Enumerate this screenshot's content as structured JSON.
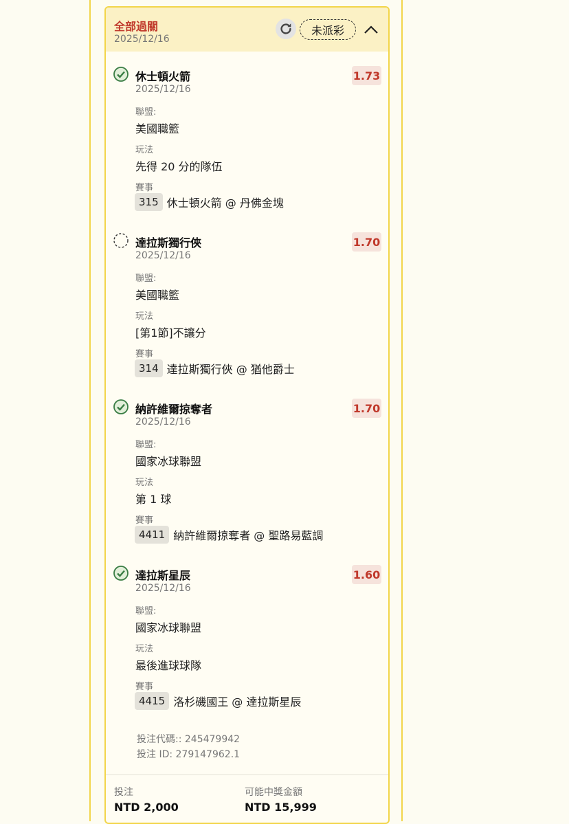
{
  "header": {
    "title": "全部過關",
    "date": "2025/12/16",
    "status": "未派彩"
  },
  "selections": [
    {
      "status": "won",
      "team": "休士頓火箭",
      "date": "2025/12/16",
      "odds": "1.73",
      "league_label": "聯盟:",
      "league": "美國職籃",
      "market_label": "玩法",
      "market": "先得 20 分的隊伍",
      "match_label": "賽事",
      "match_id": "315",
      "match_name": "休士頓火箭 @ 丹佛金塊"
    },
    {
      "status": "pending",
      "team": "達拉斯獨行俠",
      "date": "2025/12/16",
      "odds": "1.70",
      "league_label": "聯盟:",
      "league": "美國職籃",
      "market_label": "玩法",
      "market": "[第1節]不讓分",
      "match_label": "賽事",
      "match_id": "314",
      "match_name": "達拉斯獨行俠 @ 猶他爵士"
    },
    {
      "status": "won",
      "team": "納許維爾掠奪者",
      "date": "2025/12/16",
      "odds": "1.70",
      "league_label": "聯盟:",
      "league": "國家冰球聯盟",
      "market_label": "玩法",
      "market": "第 1 球",
      "match_label": "賽事",
      "match_id": "4411",
      "match_name": "納許維爾掠奪者 @ 聖路易藍調"
    },
    {
      "status": "won",
      "team": "達拉斯星辰",
      "date": "2025/12/16",
      "odds": "1.60",
      "league_label": "聯盟:",
      "league": "國家冰球聯盟",
      "market_label": "玩法",
      "market": "最後進球球隊",
      "match_label": "賽事",
      "match_id": "4415",
      "match_name": "洛杉磯國王 @ 達拉斯星辰"
    }
  ],
  "bet_info": {
    "code": "投注代碼:: 245479942",
    "id": "投注 ID: 279147962.1"
  },
  "footer": {
    "stake_label": "投注",
    "stake_value": "NTD 2,000",
    "payout_label": "可能中獎金額",
    "payout_value": "NTD 15,999"
  },
  "colors": {
    "accent_border": "#f2d54a",
    "header_bg": "#fbf1c5",
    "title_red": "#c0392b",
    "odds_bg": "#f6e3dc",
    "won_green": "#3a7d44"
  },
  "icons": {
    "refresh": "refresh-icon",
    "collapse": "chevron-up-icon",
    "won": "check-circle-icon",
    "pending": "dashed-circle-icon"
  }
}
